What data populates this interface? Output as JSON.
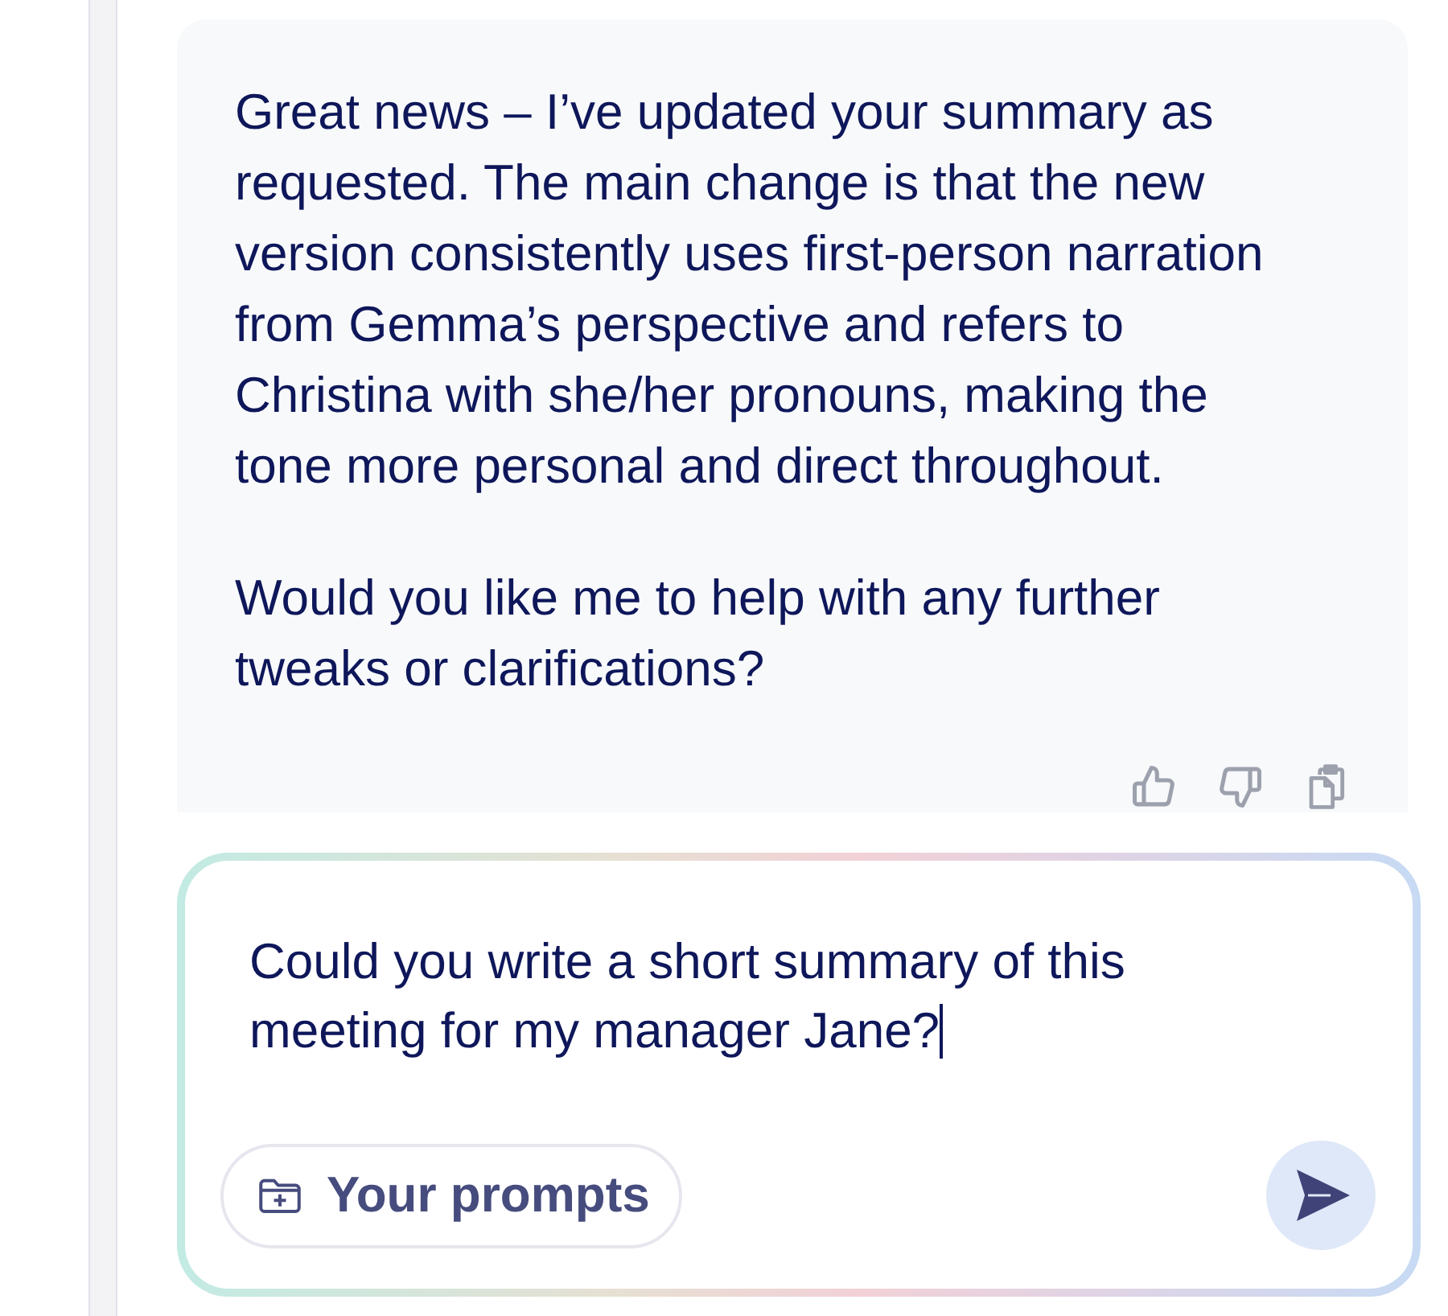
{
  "message": {
    "paragraphs": [
      "Great news – I’ve updated your summary as requested. The main change is that the new version consistently uses first-person narration from Gemma’s perspective and refers to Christina with she/her pronouns, making the tone more personal and direct throughout.",
      "Would you like me to help with any further tweaks or clarifications?"
    ],
    "actions": [
      {
        "kind": "thumbs-up"
      },
      {
        "kind": "thumbs-down"
      },
      {
        "kind": "copy"
      }
    ]
  },
  "composer": {
    "value": "Could you write a short summary of this meeting for my manager Jane?",
    "focused": true,
    "prompts_button": {
      "label": "Your prompts"
    }
  }
}
